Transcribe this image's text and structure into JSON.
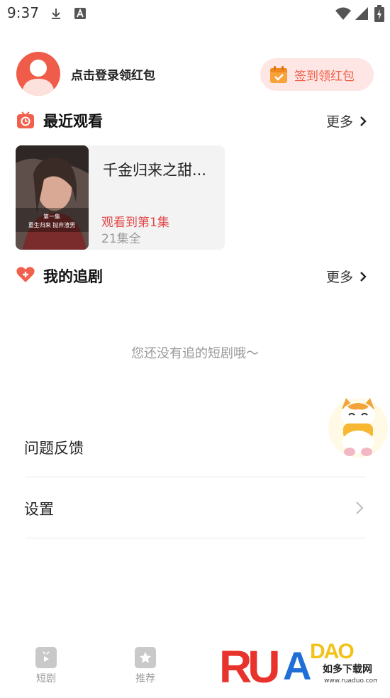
{
  "status_bar": {
    "time": "9:37",
    "icons": [
      "download-icon",
      "a-badge-icon",
      "wifi-icon",
      "signal-icon",
      "battery-icon"
    ]
  },
  "profile": {
    "login_text": "点击登录领红包",
    "checkin_button": "签到领红包"
  },
  "recent": {
    "title": "最近观看",
    "more": "更多",
    "item": {
      "title": "千金归来之甜...",
      "poster_caption_line1": "第一集",
      "poster_caption_line2": "重生归来 抛弃渣男",
      "progress": "观看到第1集",
      "episodes": "21集全"
    }
  },
  "following": {
    "title": "我的追剧",
    "more": "更多",
    "empty": "您还没有追的短剧哦～"
  },
  "menu": {
    "feedback": "问题反馈",
    "settings": "设置"
  },
  "bottom_nav": {
    "items": [
      {
        "label": "短剧",
        "icon": "play-tv-icon"
      },
      {
        "label": "推荐",
        "icon": "star-icon"
      }
    ]
  },
  "watermark": {
    "brand": "RUANDAO",
    "cn_text": "如多下载网",
    "url": "www.ruaduo.com"
  },
  "colors": {
    "accent": "#f0604c",
    "progress_red": "#e24a4a",
    "muted": "#999999"
  }
}
